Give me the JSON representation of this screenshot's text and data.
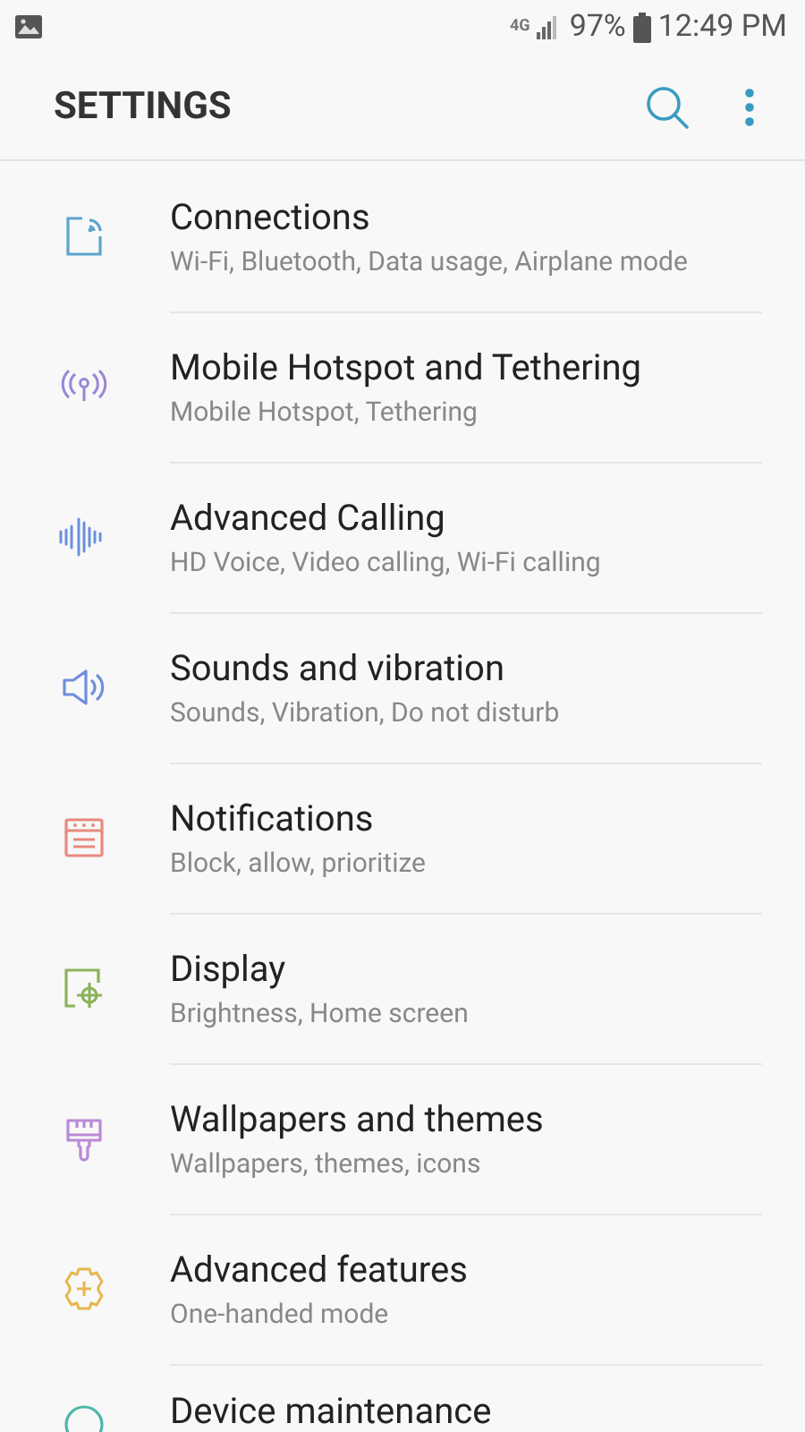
{
  "status_bar": {
    "network": "4G",
    "battery": "97%",
    "time": "12:49 PM"
  },
  "header": {
    "title": "SETTINGS"
  },
  "items": [
    {
      "title": "Connections",
      "subtitle": "Wi-Fi, Bluetooth, Data usage, Airplane mode",
      "color": "#5aa5cc"
    },
    {
      "title": "Mobile Hotspot and Tethering",
      "subtitle": "Mobile Hotspot, Tethering",
      "color": "#9a86d6"
    },
    {
      "title": "Advanced Calling",
      "subtitle": "HD Voice, Video calling, Wi-Fi calling",
      "color": "#6b8fdc"
    },
    {
      "title": "Sounds and vibration",
      "subtitle": "Sounds, Vibration, Do not disturb",
      "color": "#6f8fdc"
    },
    {
      "title": "Notifications",
      "subtitle": "Block, allow, prioritize",
      "color": "#e8897f"
    },
    {
      "title": "Display",
      "subtitle": "Brightness, Home screen",
      "color": "#8cb35a"
    },
    {
      "title": "Wallpapers and themes",
      "subtitle": "Wallpapers, themes, icons",
      "color": "#b98ad6"
    },
    {
      "title": "Advanced features",
      "subtitle": "One-handed mode",
      "color": "#e6b64f"
    },
    {
      "title": "Device maintenance",
      "color": "#4db6a8"
    }
  ]
}
